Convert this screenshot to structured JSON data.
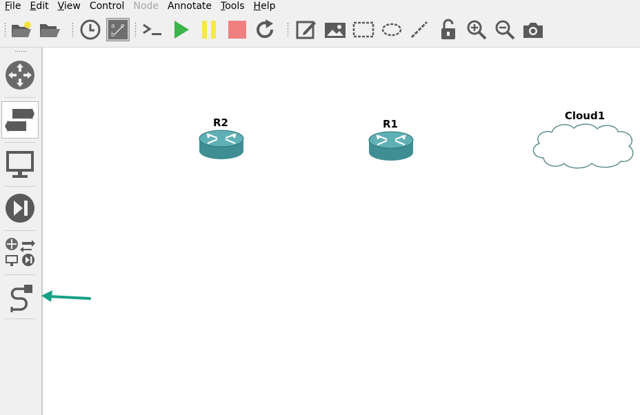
{
  "menu": {
    "items": [
      {
        "label": "File",
        "underline": "F",
        "rest": "ile",
        "enabled": true
      },
      {
        "label": "Edit",
        "underline": "E",
        "rest": "dit",
        "enabled": true
      },
      {
        "label": "View",
        "underline": "V",
        "rest": "iew",
        "enabled": true
      },
      {
        "label": "Control",
        "underline": "",
        "rest": "Control",
        "enabled": true
      },
      {
        "label": "Node",
        "underline": "",
        "rest": "Node",
        "enabled": false
      },
      {
        "label": "Annotate",
        "underline": "",
        "rest": "Annotate",
        "enabled": true
      },
      {
        "label": "Tools",
        "underline": "T",
        "rest": "ools",
        "enabled": true
      },
      {
        "label": "Help",
        "underline": "H",
        "rest": "elp",
        "enabled": true
      }
    ]
  },
  "toolbar": {
    "buttons": [
      "new-project-icon",
      "open-project-icon",
      "snapshot-clock-icon",
      "show-interface-labels-icon",
      "console-icon",
      "start-icon",
      "suspend-icon",
      "stop-icon",
      "reload-icon",
      "add-note-icon",
      "insert-image-icon",
      "draw-rectangle-icon",
      "draw-ellipse-icon",
      "draw-line-icon",
      "lock-icon",
      "zoom-in-icon",
      "zoom-out-icon",
      "screenshot-icon"
    ],
    "colors": {
      "start": "#3cb44b",
      "suspend": "#f5e84a",
      "stop": "#f08080",
      "icon": "#5a5a5a"
    }
  },
  "dock": {
    "buttons": [
      "browse-routers-icon",
      "browse-switches-icon",
      "browse-end-devices-icon",
      "browse-security-devices-icon",
      "browse-all-devices-icon",
      "add-link-icon"
    ]
  },
  "canvas": {
    "nodes": [
      {
        "label": "R2",
        "type": "router"
      },
      {
        "label": "R1",
        "type": "router"
      },
      {
        "label": "Cloud1",
        "type": "cloud"
      }
    ],
    "annotation": {
      "type": "arrow",
      "color": "#17a185"
    }
  }
}
